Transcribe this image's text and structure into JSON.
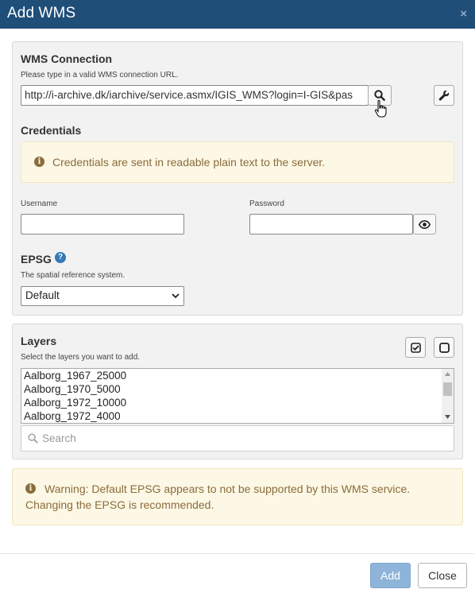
{
  "dialog": {
    "title": "Add WMS",
    "close_symbol": "×"
  },
  "wms": {
    "heading": "WMS Connection",
    "hint": "Please type in a valid WMS connection URL.",
    "url_value": "http://i-archive.dk/iarchive/service.asmx/IGIS_WMS?login=I-GIS&pas",
    "search_button_icon": "search-icon",
    "settings_button_icon": "wrench-icon"
  },
  "credentials": {
    "heading": "Credentials",
    "info_text": "Credentials are sent in readable plain text to the server.",
    "username_label": "Username",
    "username_value": "",
    "password_label": "Password",
    "password_value": "",
    "show_password_icon": "eye-icon"
  },
  "epsg": {
    "heading": "EPSG",
    "help_icon": "question-circle-icon",
    "hint": "The spatial reference system.",
    "selected": "Default"
  },
  "layers": {
    "heading": "Layers",
    "hint": "Select the layers you want to add.",
    "select_all_icon": "check-square-icon",
    "deselect_all_icon": "square-icon",
    "items": [
      "Aalborg_1967_25000",
      "Aalborg_1970_5000",
      "Aalborg_1972_10000",
      "Aalborg_1972_4000"
    ],
    "search_placeholder": "Search"
  },
  "warning": {
    "line1": "Warning: Default EPSG appears to not be supported by this WMS service.",
    "line2": "Changing the EPSG is recommended."
  },
  "footer": {
    "add_label": "Add",
    "close_label": "Close"
  },
  "colors": {
    "titlebar": "#1f4e79",
    "primary_button": "#8fb4d9",
    "alert_bg": "#fdf7e5",
    "alert_text": "#8a6d3b",
    "help_icon": "#337ab7"
  }
}
